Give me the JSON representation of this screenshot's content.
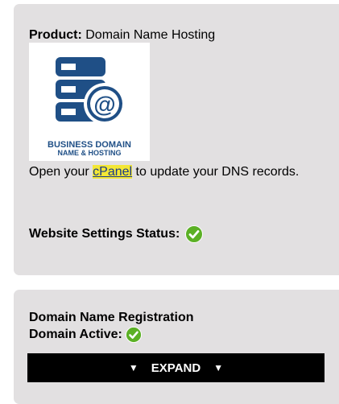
{
  "product_panel": {
    "product_label": "Product:",
    "product_name": "Domain Name Hosting",
    "logo": {
      "icon": "server-globe-icon",
      "line1": "BUSINESS DOMAIN",
      "line2": "NAME & HOSTING",
      "color": "#1f4f86"
    },
    "dns_text_before": "Open your ",
    "cpanel_link": "cPanel",
    "dns_text_after": " to update your DNS records.",
    "status_label": "Website Settings Status:",
    "status_icon": "check-circle-icon"
  },
  "domain_panel": {
    "title": "Domain Name Registration",
    "active_label": "Domain Active:",
    "active_icon": "check-circle-icon",
    "expand_label": "EXPAND",
    "expand_arrow": "▼"
  },
  "colors": {
    "panel_bg": "#e2e0e1",
    "highlight": "#f3e736",
    "check_green": "#5bb025"
  }
}
